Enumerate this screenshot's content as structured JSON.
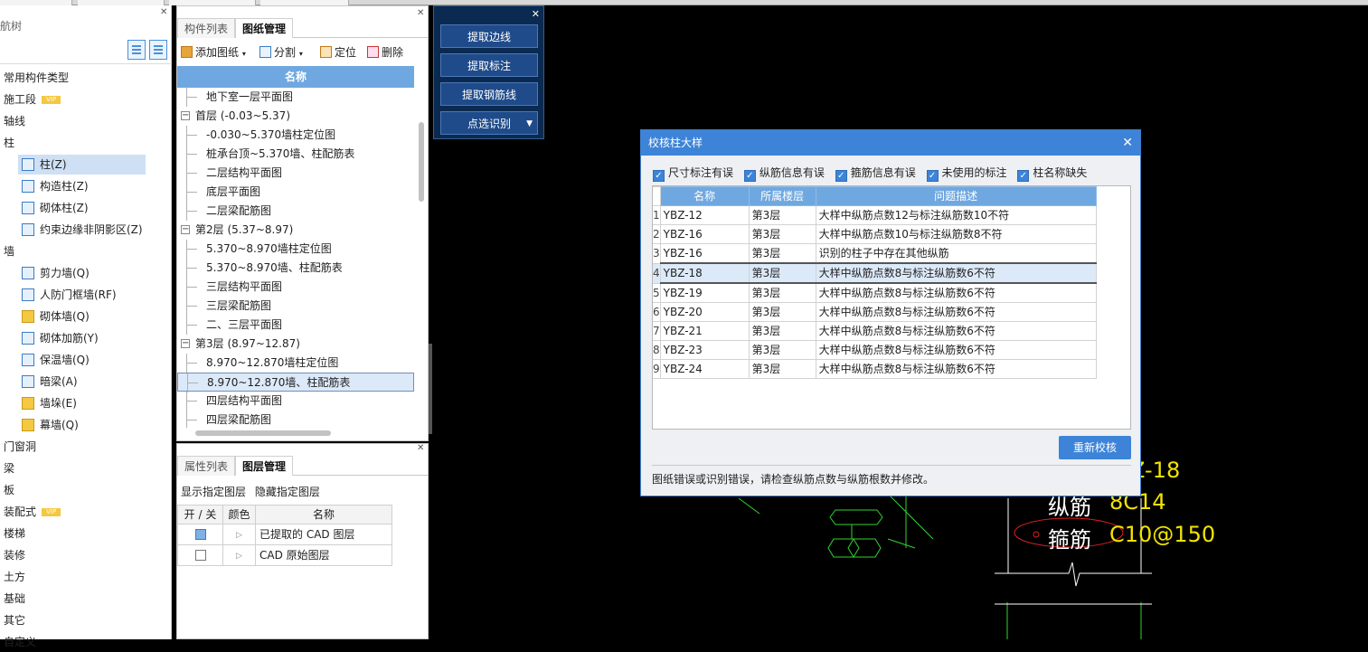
{
  "nav": {
    "title": "航树",
    "items": [
      {
        "label": "常用构件类型"
      },
      {
        "label": "施工段",
        "badge": "VIP"
      },
      {
        "label": "轴线"
      },
      {
        "label": "柱"
      },
      {
        "label": "墙"
      },
      {
        "label": "门窗洞"
      },
      {
        "label": "梁"
      },
      {
        "label": "板"
      },
      {
        "label": "装配式",
        "badge": "VIP"
      },
      {
        "label": "楼梯"
      },
      {
        "label": "装修"
      },
      {
        "label": "土方"
      },
      {
        "label": "基础"
      },
      {
        "label": "其它"
      },
      {
        "label": "自定义"
      }
    ],
    "column_items": [
      {
        "label": "柱(Z)",
        "icon": "column-icon",
        "selected": true
      },
      {
        "label": "构造柱(Z)",
        "icon": "structural-column-icon"
      },
      {
        "label": "砌体柱(Z)",
        "icon": "masonry-column-icon"
      },
      {
        "label": "约束边缘非阴影区(Z)",
        "icon": "edge-zone-icon"
      }
    ],
    "wall_items": [
      {
        "label": "剪力墙(Q)",
        "icon": "shear-wall-icon"
      },
      {
        "label": "人防门框墙(RF)",
        "icon": "door-frame-wall-icon"
      },
      {
        "label": "砌体墙(Q)",
        "icon": "masonry-wall-icon"
      },
      {
        "label": "砌体加筋(Y)",
        "icon": "masonry-rebar-icon"
      },
      {
        "label": "保温墙(Q)",
        "icon": "insulation-wall-icon"
      },
      {
        "label": "暗梁(A)",
        "icon": "hidden-beam-icon"
      },
      {
        "label": "墙垛(E)",
        "icon": "wall-pier-icon"
      },
      {
        "label": "幕墙(Q)",
        "icon": "curtain-wall-icon"
      }
    ]
  },
  "drawings": {
    "tabs": [
      "构件列表",
      "图纸管理"
    ],
    "active_tab": "图纸管理",
    "toolbar": {
      "add": "添加图纸",
      "split": "分割",
      "locate": "定位",
      "delete": "删除"
    },
    "column_header": "名称",
    "rows": [
      {
        "type": "leaf",
        "label": "地下室一层平面图"
      },
      {
        "type": "group",
        "label": "首层 (-0.03~5.37)"
      },
      {
        "type": "leaf",
        "label": "-0.030~5.370墙柱定位图"
      },
      {
        "type": "leaf",
        "label": "桩承台顶~5.370墙、柱配筋表"
      },
      {
        "type": "leaf",
        "label": "二层结构平面图"
      },
      {
        "type": "leaf",
        "label": "底层平面图"
      },
      {
        "type": "leaf",
        "label": "二层梁配筋图"
      },
      {
        "type": "group",
        "label": "第2层 (5.37~8.97)"
      },
      {
        "type": "leaf",
        "label": "5.370~8.970墙柱定位图"
      },
      {
        "type": "leaf",
        "label": "5.370~8.970墙、柱配筋表"
      },
      {
        "type": "leaf",
        "label": "三层结构平面图"
      },
      {
        "type": "leaf",
        "label": "三层梁配筋图"
      },
      {
        "type": "leaf",
        "label": "二、三层平面图"
      },
      {
        "type": "group",
        "label": "第3层 (8.97~12.87)"
      },
      {
        "type": "leaf",
        "label": "8.970~12.870墙柱定位图"
      },
      {
        "type": "leaf",
        "label": "8.970~12.870墙、柱配筋表",
        "selected": true
      },
      {
        "type": "leaf",
        "label": "四层结构平面图"
      },
      {
        "type": "leaf",
        "label": "四层梁配筋图"
      }
    ]
  },
  "layers": {
    "tabs": [
      "属性列表",
      "图层管理"
    ],
    "active_tab": "图层管理",
    "show_label": "显示指定图层",
    "hide_label": "隐藏指定图层",
    "headers": [
      "开 / 关",
      "颜色",
      "名称"
    ],
    "rows": [
      {
        "on": true,
        "name": "已提取的 CAD 图层"
      },
      {
        "on": false,
        "name": "CAD 原始图层"
      }
    ]
  },
  "extract": {
    "buttons": [
      "提取边线",
      "提取标注",
      "提取钢筋线",
      "点选识别"
    ]
  },
  "cad": {
    "label_name": "Z-18",
    "label_long": "纵筋",
    "value_long": "8C14",
    "label_stirrup": "箍筋",
    "value_stirrup": "C10@150"
  },
  "dialog": {
    "title": "校核柱大样",
    "filters": [
      {
        "label": "尺寸标注有误",
        "checked": true
      },
      {
        "label": "纵筋信息有误",
        "checked": true
      },
      {
        "label": "箍筋信息有误",
        "checked": true
      },
      {
        "label": "未使用的标注",
        "checked": true
      },
      {
        "label": "柱名称缺失",
        "checked": true
      }
    ],
    "headers": [
      "名称",
      "所属楼层",
      "问题描述"
    ],
    "rows": [
      {
        "n": "1",
        "name": "YBZ-12",
        "floor": "第3层",
        "desc": "大样中纵筋点数12与标注纵筋数10不符"
      },
      {
        "n": "2",
        "name": "YBZ-16",
        "floor": "第3层",
        "desc": "大样中纵筋点数10与标注纵筋数8不符"
      },
      {
        "n": "3",
        "name": "YBZ-16",
        "floor": "第3层",
        "desc": "识别的柱子中存在其他纵筋"
      },
      {
        "n": "4",
        "name": "YBZ-18",
        "floor": "第3层",
        "desc": "大样中纵筋点数8与标注纵筋数6不符",
        "selected": true
      },
      {
        "n": "5",
        "name": "YBZ-19",
        "floor": "第3层",
        "desc": "大样中纵筋点数8与标注纵筋数6不符"
      },
      {
        "n": "6",
        "name": "YBZ-20",
        "floor": "第3层",
        "desc": "大样中纵筋点数8与标注纵筋数6不符"
      },
      {
        "n": "7",
        "name": "YBZ-21",
        "floor": "第3层",
        "desc": "大样中纵筋点数8与标注纵筋数6不符"
      },
      {
        "n": "8",
        "name": "YBZ-23",
        "floor": "第3层",
        "desc": "大样中纵筋点数8与标注纵筋数6不符"
      },
      {
        "n": "9",
        "name": "YBZ-24",
        "floor": "第3层",
        "desc": "大样中纵筋点数8与标注纵筋数6不符"
      }
    ],
    "recheck_label": "重新校核",
    "message": "图纸错误或识别错误，请检查纵筋点数与纵筋根数并修改。"
  }
}
